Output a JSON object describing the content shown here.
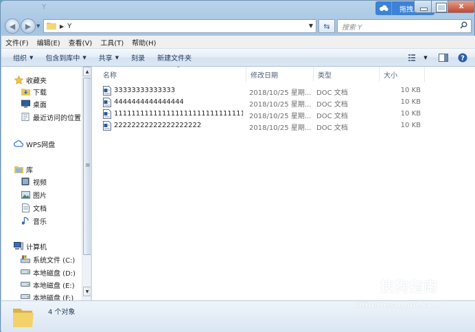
{
  "window": {
    "title": "Y",
    "upload_label": "拖拽上传",
    "close_glyph": "x"
  },
  "address": {
    "path": "Y",
    "search_placeholder": "搜索 Y"
  },
  "menu": [
    "文件(F)",
    "编辑(E)",
    "查看(V)",
    "工具(T)",
    "帮助(H)"
  ],
  "toolbar": {
    "organize": "组织",
    "include_library": "包含到库中",
    "share": "共享",
    "burn": "刻录",
    "new_folder": "新建文件夹"
  },
  "nav": {
    "favorites": "收藏夹",
    "downloads": "下载",
    "desktop": "桌面",
    "recent": "最近访问的位置",
    "wps": "WPS网盘",
    "libraries": "库",
    "videos": "视频",
    "pictures": "图片",
    "documents": "文档",
    "music": "音乐",
    "computer": "计算机",
    "drive_c": "系统文件 (C:)",
    "drive_d": "本地磁盘 (D:)",
    "drive_e": "本地磁盘 (E:)",
    "drive_f": "本地磁盘 (F:)"
  },
  "columns": {
    "name": "名称",
    "date": "修改日期",
    "type": "类型",
    "size": "大小"
  },
  "files": [
    {
      "name": "33333333333333",
      "date": "2018/10/25 星期...",
      "type": "DOC 文档",
      "size": "10 KB"
    },
    {
      "name": "4444444444444444",
      "date": "2018/10/25 星期...",
      "type": "DOC 文档",
      "size": "10 KB"
    },
    {
      "name": "1111111111111111111111111111111...",
      "date": "2018/10/25 星期...",
      "type": "DOC 文档",
      "size": "10 KB"
    },
    {
      "name": "22222222222222222222",
      "date": "2018/10/25 星期...",
      "type": "DOC 文档",
      "size": "10 KB"
    }
  ],
  "status": {
    "count": "4 个对象"
  },
  "watermark": {
    "brand": "搜狗指南",
    "domain": "zhinan.sogou.com"
  }
}
